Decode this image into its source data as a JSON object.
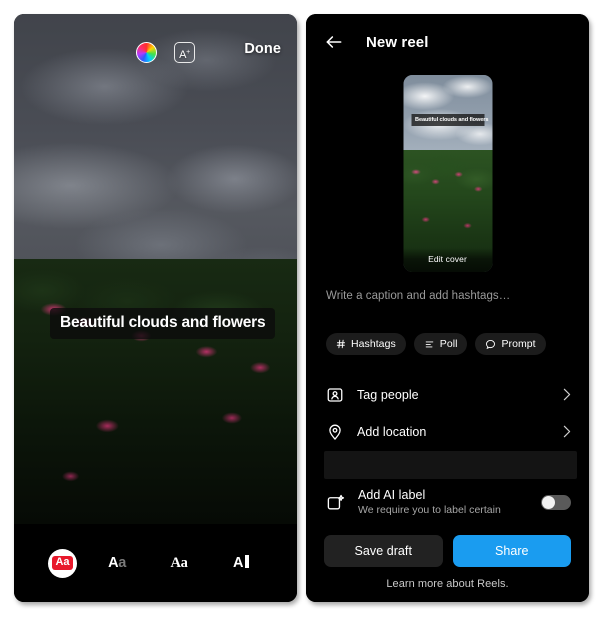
{
  "left_panel": {
    "toolbar": {
      "color_wheel_icon": "color-wheel-icon",
      "text_effect_label": "A",
      "text_effect_sup": "+",
      "done_label": "Done"
    },
    "photo": {
      "caption_overlay_text": "Beautiful clouds and flowers"
    },
    "font_bar": {
      "items": [
        {
          "label": "Aa",
          "style": "classic",
          "selected": true
        },
        {
          "label": "Aa",
          "style": "modern",
          "selected": false
        },
        {
          "label": "Aa",
          "style": "neon",
          "selected": false
        },
        {
          "label": "A",
          "style": "typewriter",
          "selected": false
        }
      ]
    }
  },
  "right_panel": {
    "header": {
      "back_icon": "back-arrow-icon",
      "title": "New reel"
    },
    "cover": {
      "caption_text": "Beautiful clouds and flowers",
      "edit_cover_label": "Edit cover"
    },
    "caption": {
      "placeholder": "Write a caption and add hashtags…",
      "value": ""
    },
    "chips": [
      {
        "icon": "hashtag-icon",
        "label": "Hashtags"
      },
      {
        "icon": "poll-icon",
        "label": "Poll"
      },
      {
        "icon": "prompt-icon",
        "label": "Prompt"
      }
    ],
    "rows": [
      {
        "icon": "tag-people-icon",
        "label": "Tag people",
        "chevron": "chevron-right-icon"
      },
      {
        "icon": "location-pin-icon",
        "label": "Add location",
        "chevron": "chevron-right-icon"
      }
    ],
    "ai_label": {
      "icon": "ai-sparkle-icon",
      "title": "Add AI label",
      "subtitle": "We require you to label certain",
      "toggle_state": "off"
    },
    "actions": {
      "save_draft_label": "Save draft",
      "share_label": "Share",
      "share_color": "#1a9cf0"
    },
    "footer": {
      "learn_more_label": "Learn more about Reels."
    }
  }
}
